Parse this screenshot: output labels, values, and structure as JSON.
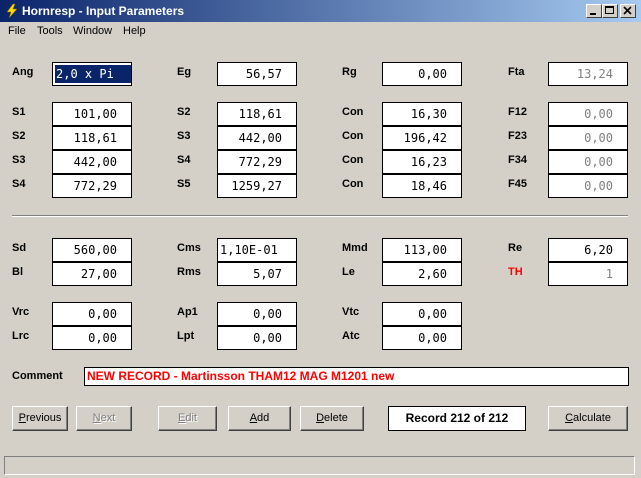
{
  "window": {
    "title": "Hornresp - Input Parameters"
  },
  "menu": [
    "File",
    "Tools",
    "Window",
    "Help"
  ],
  "params": {
    "ang": {
      "label": "Ang",
      "value": "2,0 x Pi"
    },
    "eg": {
      "label": "Eg",
      "value": "56,57"
    },
    "rg": {
      "label": "Rg",
      "value": "0,00"
    },
    "fta": {
      "label": "Fta",
      "value": "13,24"
    },
    "s1": {
      "label": "S1",
      "value": "101,00"
    },
    "s2a": {
      "label": "S2",
      "value": "118,61"
    },
    "s3a": {
      "label": "S3",
      "value": "442,00"
    },
    "s4a": {
      "label": "S4",
      "value": "772,29"
    },
    "s2b": {
      "label": "S2",
      "value": "118,61"
    },
    "s3b": {
      "label": "S3",
      "value": "442,00"
    },
    "s4b": {
      "label": "S4",
      "value": "772,29"
    },
    "s5": {
      "label": "S5",
      "value": "1259,27"
    },
    "con1": {
      "label": "Con",
      "value": "16,30"
    },
    "con2": {
      "label": "Con",
      "value": "196,42"
    },
    "con3": {
      "label": "Con",
      "value": "16,23"
    },
    "con4": {
      "label": "Con",
      "value": "18,46"
    },
    "f12": {
      "label": "F12",
      "value": "0,00"
    },
    "f23": {
      "label": "F23",
      "value": "0,00"
    },
    "f34": {
      "label": "F34",
      "value": "0,00"
    },
    "f45": {
      "label": "F45",
      "value": "0,00"
    },
    "sd": {
      "label": "Sd",
      "value": "560,00"
    },
    "cms": {
      "label": "Cms",
      "value": "1,10E-01"
    },
    "mmd": {
      "label": "Mmd",
      "value": "113,00"
    },
    "re": {
      "label": "Re",
      "value": "6,20"
    },
    "bl": {
      "label": "Bl",
      "value": "27,00"
    },
    "rms": {
      "label": "Rms",
      "value": "5,07"
    },
    "le": {
      "label": "Le",
      "value": "2,60"
    },
    "th": {
      "label": "TH",
      "value": "1"
    },
    "vrc": {
      "label": "Vrc",
      "value": "0,00"
    },
    "ap1": {
      "label": "Ap1",
      "value": "0,00"
    },
    "vtc": {
      "label": "Vtc",
      "value": "0,00"
    },
    "lrc": {
      "label": "Lrc",
      "value": "0,00"
    },
    "lpt": {
      "label": "Lpt",
      "value": "0,00"
    },
    "atc": {
      "label": "Atc",
      "value": "0,00"
    }
  },
  "comment": {
    "label": "Comment",
    "value": "NEW RECORD - Martinsson THAM12 MAG M1201 new"
  },
  "buttons": {
    "previous": {
      "u": "P",
      "rest": "revious"
    },
    "next": {
      "u": "N",
      "rest": "ext"
    },
    "edit": {
      "u": "E",
      "rest": "dit"
    },
    "add": {
      "u": "A",
      "rest": "dd"
    },
    "delete": {
      "u": "D",
      "rest": "elete"
    },
    "calculate": {
      "u": "C",
      "rest": "alculate"
    }
  },
  "record": "Record 212 of 212",
  "colors": {
    "title_start": "#0a246a",
    "title_end": "#a6caf0",
    "face": "#d4d0c8",
    "comment_text": "#ff0000",
    "th_label": "#ff0000",
    "readonly_text": "#808080"
  },
  "icons": [
    "lightning-icon",
    "minimize-icon",
    "maximize-icon",
    "close-icon"
  ]
}
